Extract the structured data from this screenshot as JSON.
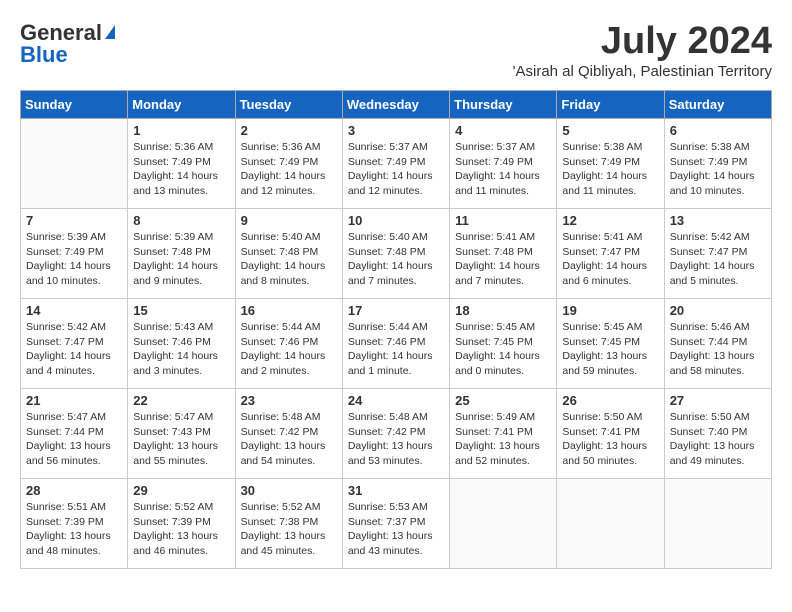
{
  "logo": {
    "general": "General",
    "blue": "Blue"
  },
  "title": {
    "month_year": "July 2024",
    "location": "'Asirah al Qibliyah, Palestinian Territory"
  },
  "days_of_week": [
    "Sunday",
    "Monday",
    "Tuesday",
    "Wednesday",
    "Thursday",
    "Friday",
    "Saturday"
  ],
  "weeks": [
    [
      {
        "day": "",
        "info": ""
      },
      {
        "day": "1",
        "info": "Sunrise: 5:36 AM\nSunset: 7:49 PM\nDaylight: 14 hours\nand 13 minutes."
      },
      {
        "day": "2",
        "info": "Sunrise: 5:36 AM\nSunset: 7:49 PM\nDaylight: 14 hours\nand 12 minutes."
      },
      {
        "day": "3",
        "info": "Sunrise: 5:37 AM\nSunset: 7:49 PM\nDaylight: 14 hours\nand 12 minutes."
      },
      {
        "day": "4",
        "info": "Sunrise: 5:37 AM\nSunset: 7:49 PM\nDaylight: 14 hours\nand 11 minutes."
      },
      {
        "day": "5",
        "info": "Sunrise: 5:38 AM\nSunset: 7:49 PM\nDaylight: 14 hours\nand 11 minutes."
      },
      {
        "day": "6",
        "info": "Sunrise: 5:38 AM\nSunset: 7:49 PM\nDaylight: 14 hours\nand 10 minutes."
      }
    ],
    [
      {
        "day": "7",
        "info": "Sunrise: 5:39 AM\nSunset: 7:49 PM\nDaylight: 14 hours\nand 10 minutes."
      },
      {
        "day": "8",
        "info": "Sunrise: 5:39 AM\nSunset: 7:48 PM\nDaylight: 14 hours\nand 9 minutes."
      },
      {
        "day": "9",
        "info": "Sunrise: 5:40 AM\nSunset: 7:48 PM\nDaylight: 14 hours\nand 8 minutes."
      },
      {
        "day": "10",
        "info": "Sunrise: 5:40 AM\nSunset: 7:48 PM\nDaylight: 14 hours\nand 7 minutes."
      },
      {
        "day": "11",
        "info": "Sunrise: 5:41 AM\nSunset: 7:48 PM\nDaylight: 14 hours\nand 7 minutes."
      },
      {
        "day": "12",
        "info": "Sunrise: 5:41 AM\nSunset: 7:47 PM\nDaylight: 14 hours\nand 6 minutes."
      },
      {
        "day": "13",
        "info": "Sunrise: 5:42 AM\nSunset: 7:47 PM\nDaylight: 14 hours\nand 5 minutes."
      }
    ],
    [
      {
        "day": "14",
        "info": "Sunrise: 5:42 AM\nSunset: 7:47 PM\nDaylight: 14 hours\nand 4 minutes."
      },
      {
        "day": "15",
        "info": "Sunrise: 5:43 AM\nSunset: 7:46 PM\nDaylight: 14 hours\nand 3 minutes."
      },
      {
        "day": "16",
        "info": "Sunrise: 5:44 AM\nSunset: 7:46 PM\nDaylight: 14 hours\nand 2 minutes."
      },
      {
        "day": "17",
        "info": "Sunrise: 5:44 AM\nSunset: 7:46 PM\nDaylight: 14 hours\nand 1 minute."
      },
      {
        "day": "18",
        "info": "Sunrise: 5:45 AM\nSunset: 7:45 PM\nDaylight: 14 hours\nand 0 minutes."
      },
      {
        "day": "19",
        "info": "Sunrise: 5:45 AM\nSunset: 7:45 PM\nDaylight: 13 hours\nand 59 minutes."
      },
      {
        "day": "20",
        "info": "Sunrise: 5:46 AM\nSunset: 7:44 PM\nDaylight: 13 hours\nand 58 minutes."
      }
    ],
    [
      {
        "day": "21",
        "info": "Sunrise: 5:47 AM\nSunset: 7:44 PM\nDaylight: 13 hours\nand 56 minutes."
      },
      {
        "day": "22",
        "info": "Sunrise: 5:47 AM\nSunset: 7:43 PM\nDaylight: 13 hours\nand 55 minutes."
      },
      {
        "day": "23",
        "info": "Sunrise: 5:48 AM\nSunset: 7:42 PM\nDaylight: 13 hours\nand 54 minutes."
      },
      {
        "day": "24",
        "info": "Sunrise: 5:48 AM\nSunset: 7:42 PM\nDaylight: 13 hours\nand 53 minutes."
      },
      {
        "day": "25",
        "info": "Sunrise: 5:49 AM\nSunset: 7:41 PM\nDaylight: 13 hours\nand 52 minutes."
      },
      {
        "day": "26",
        "info": "Sunrise: 5:50 AM\nSunset: 7:41 PM\nDaylight: 13 hours\nand 50 minutes."
      },
      {
        "day": "27",
        "info": "Sunrise: 5:50 AM\nSunset: 7:40 PM\nDaylight: 13 hours\nand 49 minutes."
      }
    ],
    [
      {
        "day": "28",
        "info": "Sunrise: 5:51 AM\nSunset: 7:39 PM\nDaylight: 13 hours\nand 48 minutes."
      },
      {
        "day": "29",
        "info": "Sunrise: 5:52 AM\nSunset: 7:39 PM\nDaylight: 13 hours\nand 46 minutes."
      },
      {
        "day": "30",
        "info": "Sunrise: 5:52 AM\nSunset: 7:38 PM\nDaylight: 13 hours\nand 45 minutes."
      },
      {
        "day": "31",
        "info": "Sunrise: 5:53 AM\nSunset: 7:37 PM\nDaylight: 13 hours\nand 43 minutes."
      },
      {
        "day": "",
        "info": ""
      },
      {
        "day": "",
        "info": ""
      },
      {
        "day": "",
        "info": ""
      }
    ]
  ]
}
